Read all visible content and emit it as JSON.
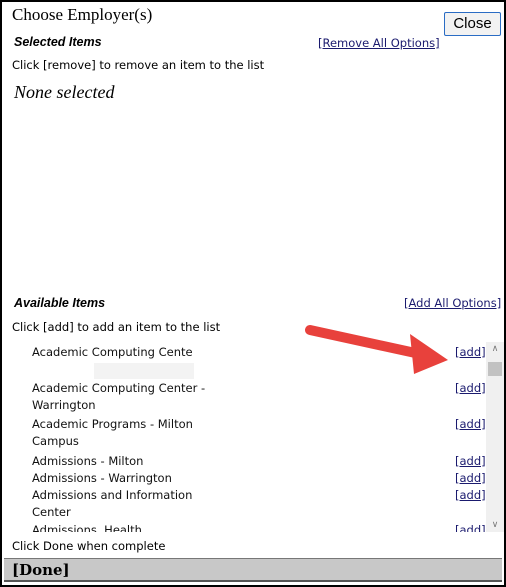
{
  "dialog": {
    "title": "Choose Employer(s)",
    "close_label": "Close"
  },
  "selected": {
    "heading": "Selected Items",
    "remove_all_label": "[Remove All Options]",
    "hint": "Click [remove] to remove an item to the list",
    "empty_text": "None selected"
  },
  "available": {
    "heading": "Available Items",
    "add_all_label": "[Add All Options]",
    "hint": "Click [add] to add an item to the list",
    "add_label": "[add]",
    "items": [
      {
        "name": "Academic Computing Cente"
      },
      {
        "name": "Academic Computing Center - Warrington"
      },
      {
        "name": "Academic Programs - Milton Campus"
      },
      {
        "name": "Admissions - Milton"
      },
      {
        "name": "Admissions - Warrington"
      },
      {
        "name": "Admissions and Information Center"
      },
      {
        "name": "Admissions, Health"
      }
    ]
  },
  "footer": {
    "done_hint": "Click Done when complete",
    "done_label": "[Done]"
  },
  "annotation": {
    "arrow_color": "#e8413c"
  }
}
